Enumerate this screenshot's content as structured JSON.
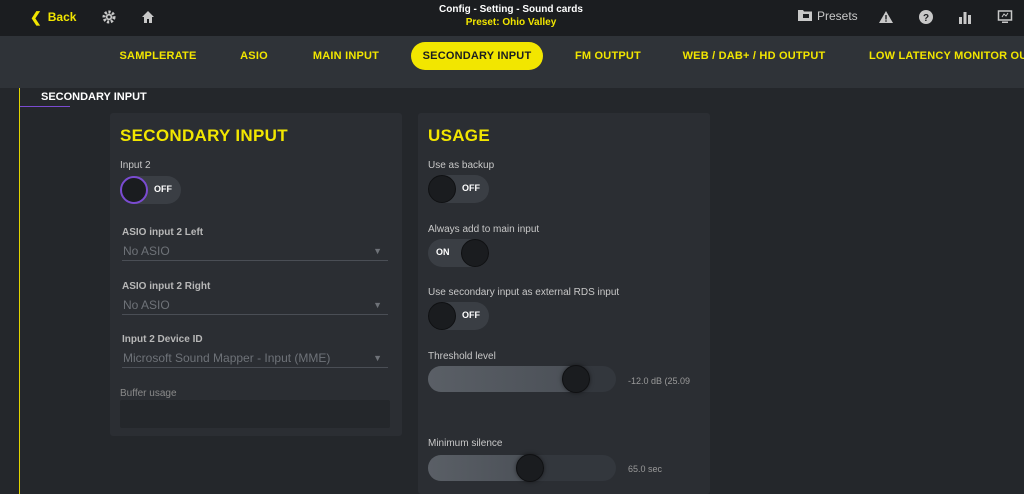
{
  "topbar": {
    "back_label": "Back",
    "title": "Config - Setting - Sound cards",
    "preset": "Preset: Ohio Valley",
    "presets_label": "Presets",
    "accent": "#f2e600"
  },
  "tabs": [
    {
      "label": "SAMPLERATE",
      "active": false
    },
    {
      "label": "ASIO",
      "active": false
    },
    {
      "label": "MAIN INPUT",
      "active": false
    },
    {
      "label": "SECONDARY INPUT",
      "active": true
    },
    {
      "label": "FM OUTPUT",
      "active": false
    },
    {
      "label": "WEB / DAB+ / HD OUTPUT",
      "active": false
    },
    {
      "label": "LOW LATENCY MONITOR OU",
      "active": false
    }
  ],
  "breadcrumb": "SECONDARY INPUT",
  "left_panel": {
    "title": "SECONDARY INPUT",
    "input2_label": "Input 2",
    "input2_state": "OFF",
    "asio_left_label": "ASIO input 2 Left",
    "asio_left_value": "No ASIO",
    "asio_right_label": "ASIO input 2 Right",
    "asio_right_value": "No ASIO",
    "device_label": "Input 2 Device ID",
    "device_value": "Microsoft Sound Mapper - Input (MME)",
    "buffer_label": "Buffer usage"
  },
  "right_panel": {
    "title": "USAGE",
    "backup_label": "Use as backup",
    "backup_state": "OFF",
    "always_add_label": "Always add to main input",
    "always_add_state": "ON",
    "rds_label": "Use secondary input as external RDS input",
    "rds_state": "OFF",
    "threshold_label": "Threshold level",
    "threshold_value": "-12.0 dB (25.09",
    "threshold_level": 0.84,
    "silence_label": "Minimum silence",
    "silence_value": "65.0 sec",
    "silence_level": 0.55
  }
}
